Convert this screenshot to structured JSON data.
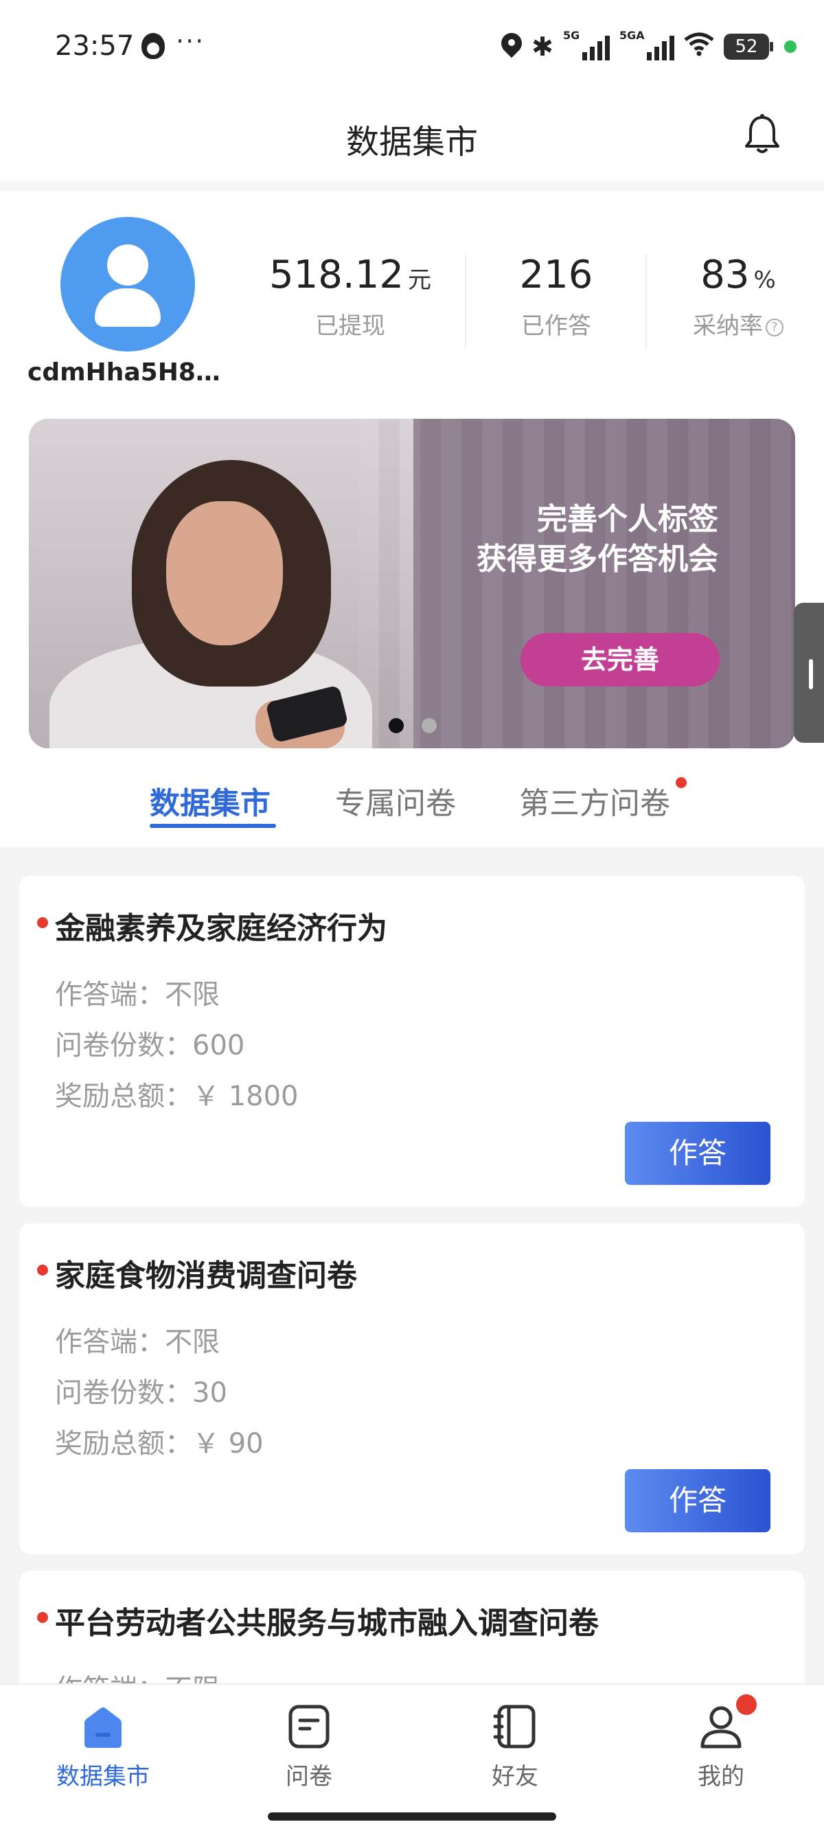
{
  "status_bar": {
    "time": "23:57",
    "more": "···",
    "sim1_label": "5G",
    "sim2_label": "5GA",
    "battery": "52"
  },
  "header": {
    "title": "数据集市"
  },
  "profile": {
    "username": "cdmHha5H8…",
    "stats": [
      {
        "value": "518.12",
        "unit": "元",
        "label": "已提现"
      },
      {
        "value": "216",
        "unit": "",
        "label": "已作答"
      },
      {
        "value": "83",
        "unit": "%",
        "label": "采纳率"
      }
    ]
  },
  "banner": {
    "line1": "完善个人标签",
    "line2": "获得更多作答机会",
    "button": "去完善",
    "slides_total": 2,
    "active_slide": 0
  },
  "tabs": [
    {
      "label": "数据集市",
      "active": true
    },
    {
      "label": "专属问卷",
      "active": false
    },
    {
      "label": "第三方问卷",
      "active": false,
      "badge": true
    }
  ],
  "surveys": [
    {
      "title": "金融素养及家庭经济行为",
      "platform": "作答端：不限",
      "copies": "问卷份数：600",
      "reward": "奖励总额：￥  1800",
      "button": "作答"
    },
    {
      "title": "家庭食物消费调查问卷",
      "platform": "作答端：不限",
      "copies": "问卷份数：30",
      "reward": "奖励总额：￥  90",
      "button": "作答"
    },
    {
      "title": "平台劳动者公共服务与城市融入调查问卷",
      "platform": "作答端：不限"
    }
  ],
  "bottom_nav": [
    {
      "label": "数据集市",
      "icon": "home-icon",
      "active": true
    },
    {
      "label": "问卷",
      "icon": "questionnaire-icon",
      "active": false
    },
    {
      "label": "好友",
      "icon": "friends-book-icon",
      "active": false
    },
    {
      "label": "我的",
      "icon": "profile-icon",
      "active": false,
      "badge": true
    }
  ],
  "colors": {
    "accent": "#2f6ad8",
    "badge": "#e63a2e",
    "avatar": "#4e9bf0",
    "banner_button": "#c23f93"
  }
}
